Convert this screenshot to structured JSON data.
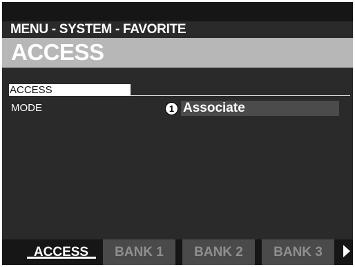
{
  "breadcrumb": "MENU - SYSTEM - FAVORITE",
  "title": "ACCESS",
  "section": {
    "label": "ACCESS"
  },
  "param": {
    "label": "MODE",
    "value": "Associate",
    "callout": "1"
  },
  "tabs": [
    {
      "label": "ACCESS",
      "active": true
    },
    {
      "label": "BANK 1",
      "active": false
    },
    {
      "label": "BANK 2",
      "active": false
    },
    {
      "label": "BANK 3",
      "active": false
    }
  ],
  "icons": {
    "next_page": "play-arrow-right-icon",
    "callout": "circled-number-icon"
  }
}
